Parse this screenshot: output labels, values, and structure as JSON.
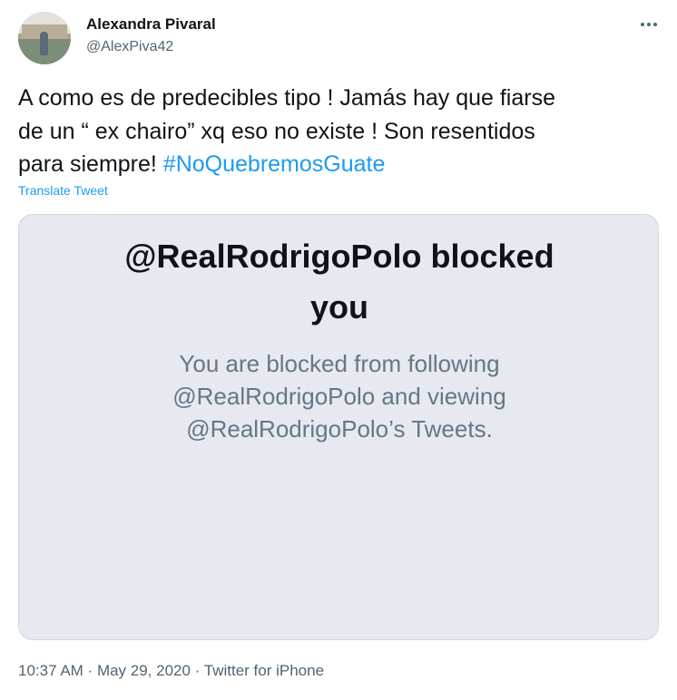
{
  "author": {
    "name": "Alexandra Pivaral",
    "handle": "@AlexPiva42"
  },
  "tweet": {
    "text_line1": "A como es de predecibles tipo ! Jamás hay que fiarse",
    "text_line2": "de un “ ex chairo” xq eso no existe ! Son resentidos",
    "text_line3_prefix": "para siempre! ",
    "hashtag": "#NoQuebremosGuate",
    "translate_label": "Translate Tweet"
  },
  "blocked_card": {
    "title_line1": "@RealRodrigoPolo blocked",
    "title_line2": "you",
    "body_line1": "You are blocked from following",
    "body_line2": "@RealRodrigoPolo and viewing",
    "body_line3": "@RealRodrigoPolo’s Tweets."
  },
  "meta": {
    "time": "10:37 AM",
    "sep1": " · ",
    "date": "May 29, 2020",
    "sep2": " · ",
    "source": "Twitter for iPhone"
  },
  "icons": {
    "more": "more-options-icon"
  },
  "colors": {
    "link": "#1d9bf0",
    "secondary_text": "#536471",
    "card_bg": "#e6e9ef"
  }
}
